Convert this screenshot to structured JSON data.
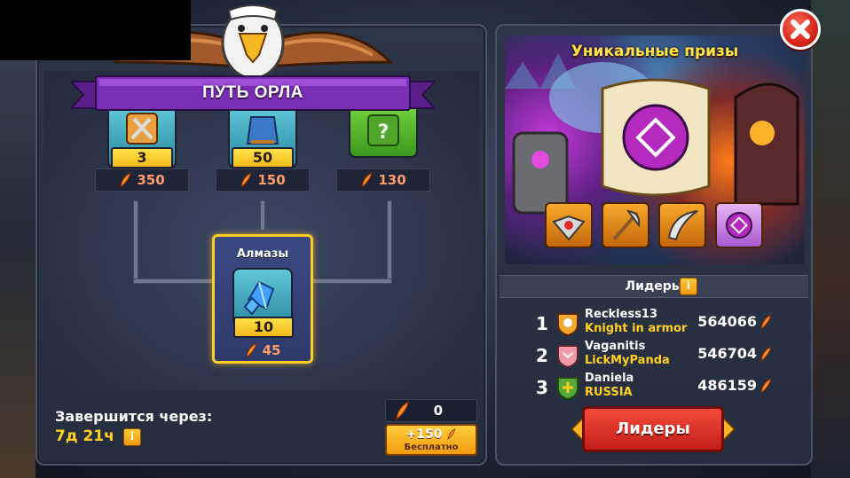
{
  "header": {
    "ribbon_title": "ПУТЬ ОРЛА"
  },
  "rewards": [
    {
      "quantity": "3",
      "cost": "350",
      "icon": "swords-chest-icon"
    },
    {
      "quantity": "50",
      "cost": "150",
      "icon": "armor-pile-icon"
    },
    {
      "quantity": "",
      "cost": "130",
      "icon": "mystery-reward-icon"
    }
  ],
  "selected_reward": {
    "title": "Алмазы",
    "quantity": "10",
    "cost": "45",
    "icon": "diamonds-icon"
  },
  "timer": {
    "label": "Завершится через:",
    "value": "7д 21ч"
  },
  "feathers": {
    "count": "0",
    "free_amount": "+150",
    "free_label": "Бесплатно"
  },
  "prizes": {
    "title": "Уникальные призы",
    "items": [
      "winged-amulet-icon",
      "battle-axe-icon",
      "curved-blade-icon",
      "rune-scroll-icon"
    ]
  },
  "leaderboard": {
    "title": "Лидеры",
    "button_label": "Лидеры",
    "rows": [
      {
        "rank": "1",
        "name": "Reckless13",
        "guild": "Knight in armor",
        "score": "564066"
      },
      {
        "rank": "2",
        "name": "Vaganitis",
        "guild": "LickMyPanda",
        "score": "546704"
      },
      {
        "rank": "3",
        "name": "Daniela",
        "guild": "RUSSIA",
        "score": "486159"
      }
    ]
  },
  "colors": {
    "accent_gold": "#ffd021",
    "feather_orange": "#ff9c6b",
    "ribbon_purple": "#7b2fb5",
    "leaders_button_red": "#e03a2c"
  }
}
